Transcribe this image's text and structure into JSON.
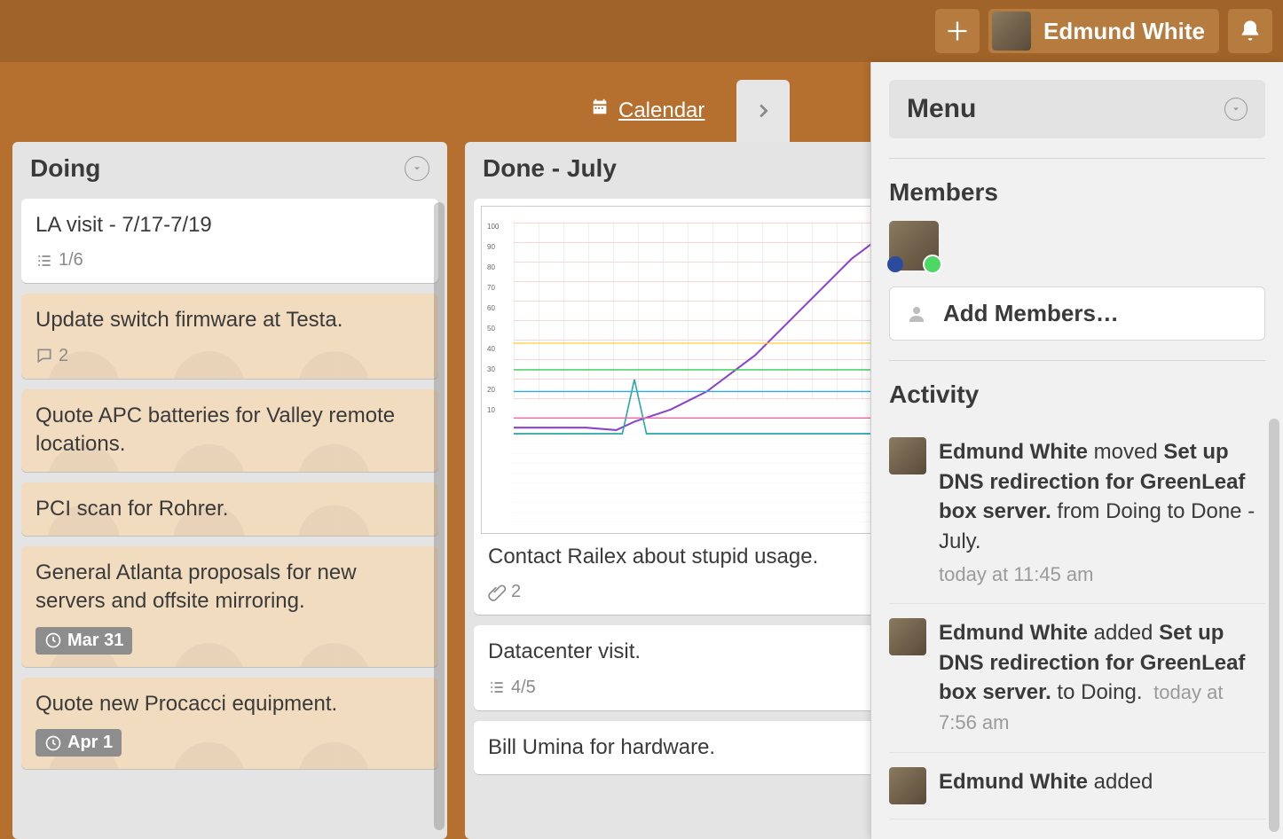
{
  "header": {
    "user_name": "Edmund White"
  },
  "subheader": {
    "calendar_label": "Calendar"
  },
  "lists": {
    "doing": {
      "title": "Doing",
      "cards": [
        {
          "title": "LA visit - 7/17-7/19",
          "checklist": "1/6"
        },
        {
          "title": "Update switch firmware at Testa.",
          "comments": "2"
        },
        {
          "title": "Quote APC batteries for Valley remote locations."
        },
        {
          "title": "PCI scan for Rohrer."
        },
        {
          "title": "General Atlanta proposals for new servers and offsite mirroring.",
          "due": "Mar 31"
        },
        {
          "title": "Quote new Procacci equipment.",
          "due": "Apr 1"
        }
      ]
    },
    "done": {
      "title": "Done - July",
      "cards": [
        {
          "title": "Contact Railex about stupid usage.",
          "attachments": "2"
        },
        {
          "title": "Datacenter visit.",
          "checklist": "4/5"
        },
        {
          "title": "Bill Umina for hardware."
        }
      ]
    }
  },
  "menu": {
    "title": "Menu",
    "members_heading": "Members",
    "add_members_label": "Add Members…",
    "activity_heading": "Activity",
    "activity": [
      {
        "actor": "Edmund White",
        "verb": "moved",
        "subject": "Set up DNS redirection for GreenLeaf box server.",
        "suffix": "from Doing to Done - July.",
        "time": "today at 11:45 am"
      },
      {
        "actor": "Edmund White",
        "verb": "added",
        "subject": "Set up DNS redirection for GreenLeaf box server.",
        "suffix": "to Doing.",
        "time": "today at 7:56 am"
      },
      {
        "actor": "Edmund White",
        "verb": "added",
        "subject": "",
        "suffix": "",
        "time": ""
      }
    ]
  }
}
